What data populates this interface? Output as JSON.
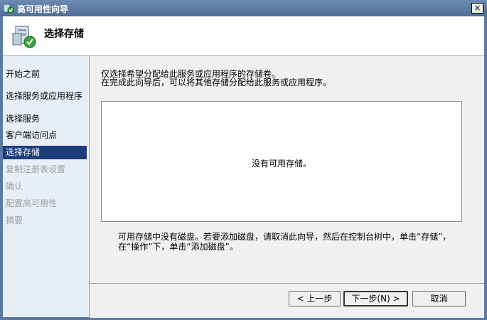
{
  "window": {
    "title": "高可用性向导",
    "close_label": "×"
  },
  "header": {
    "title": "选择存储"
  },
  "sidebar": {
    "items": [
      {
        "label": "开始之前",
        "state": "normal"
      },
      {
        "label": "选择服务或应用程序",
        "state": "normal"
      },
      {
        "label": "选择服务",
        "state": "normal"
      },
      {
        "label": "客户端访问点",
        "state": "normal"
      },
      {
        "label": "选择存储",
        "state": "active"
      },
      {
        "label": "复制注册表设置",
        "state": "disabled"
      },
      {
        "label": "确认",
        "state": "disabled"
      },
      {
        "label": "配置高可用性",
        "state": "disabled"
      },
      {
        "label": "摘要",
        "state": "disabled"
      }
    ]
  },
  "main": {
    "intro_line1": "仅选择希望分配给此服务或应用程序的存储卷。",
    "intro_line2": "在完成此向导后，可以将其他存储分配给此服务或应用程序。",
    "empty_message": "没有可用存储。",
    "note": "可用存储中没有磁盘。若要添加磁盘，请取消此向导，然后在控制台树中，单击“存储”，在“操作”下，单击“添加磁盘”。"
  },
  "footer": {
    "prev_label": "< 上一步",
    "next_label": "下一步(N) >",
    "cancel_label": "取消"
  },
  "colors": {
    "titlebar": "#5a7aa5",
    "sidebar_active": "#1e3c7a",
    "sidebar_bg": "#e8eef6"
  }
}
